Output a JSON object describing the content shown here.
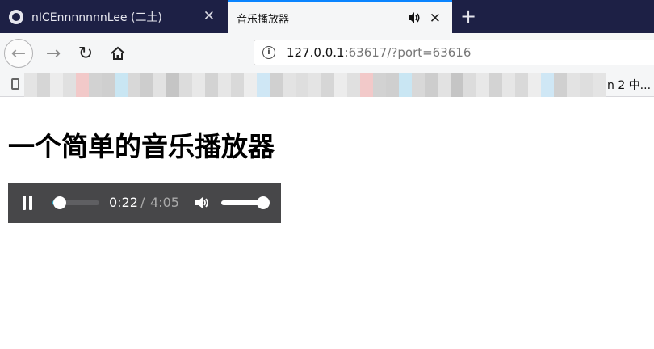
{
  "tabs": [
    {
      "title": "nICEnnnnnnnLee (二土)",
      "active": false
    },
    {
      "title": "音乐播放器",
      "active": true,
      "playing_audio": true
    }
  ],
  "navbar": {
    "url_host": "127.0.0.1",
    "url_rest": ":63617/?port=63616"
  },
  "bookmarks": {
    "trailing_text": "n 2 中...",
    "blur_colors": [
      "#e4e4e4",
      "#d6d6d6",
      "#ececec",
      "#e0e0e0",
      "#f2c9c9",
      "#d2d2d2",
      "#cfcfcf",
      "#c9e6f3",
      "#d8d8d8",
      "#cdcdcd",
      "#e2e2e2",
      "#c5c5c5",
      "#dcdcdc",
      "#e8e8e8",
      "#d3d3d3",
      "#e6e6e6",
      "#d9d9d9",
      "#ededed",
      "#cfe7f5",
      "#d0d0d0",
      "#e3e3e3",
      "#dedede"
    ]
  },
  "page": {
    "title": "一个简单的音乐播放器"
  },
  "player": {
    "current_time": "0:22",
    "separator": "/",
    "total_time": "4:05",
    "progress": 0.09,
    "volume": 1.0,
    "state": "playing"
  },
  "colors": {
    "tabbar_bg": "#1d2045",
    "tab_accent": "#0a84ff",
    "player_bg": "#474749",
    "progress_fill": "#2fb0cf"
  },
  "icons": {
    "tab_favicon": "github-icon",
    "tab_close": "close-icon",
    "audio": "speaker-icon",
    "new_tab": "plus-icon",
    "back": "arrow-left-icon",
    "forward": "arrow-right-icon",
    "reload": "reload-icon",
    "home": "home-icon",
    "site_info": "info-icon",
    "bookmarks_folder": "folder-icon",
    "pause": "pause-icon",
    "volume": "volume-icon"
  }
}
